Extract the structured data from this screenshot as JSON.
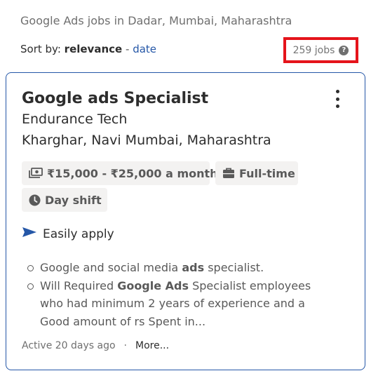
{
  "search": {
    "heading": "Google Ads jobs in Dadar, Mumbai, Maharashtra",
    "sort_label": "Sort by:",
    "sort_active": "relevance",
    "sort_separator": "-",
    "sort_alt": "date",
    "job_count": "259 jobs",
    "help_icon": "question-circle-icon"
  },
  "job": {
    "title": "Google ads Specialist",
    "company": "Endurance Tech",
    "location": "Kharghar, Navi Mumbai, Maharashtra",
    "salary": "₹15,000 - ₹25,000 a month",
    "job_type": "Full-time",
    "shift": "Day shift",
    "apply_label": "Easily apply",
    "snippet": [
      {
        "pre": "Google and social media ",
        "bold": "ads",
        "post": " specialist."
      },
      {
        "pre": "Will Required ",
        "bold": "Google Ads",
        "post": " Specialist employees who had minimum 2 years of experience and a Good amount of rs Spent in..."
      }
    ],
    "posted": "Active 20 days ago",
    "footer_separator": "·",
    "more_label": "More..."
  },
  "colors": {
    "accent_blue": "#2557a7",
    "highlight_red": "#e5141b",
    "chip_bg": "#f3f2f1"
  }
}
